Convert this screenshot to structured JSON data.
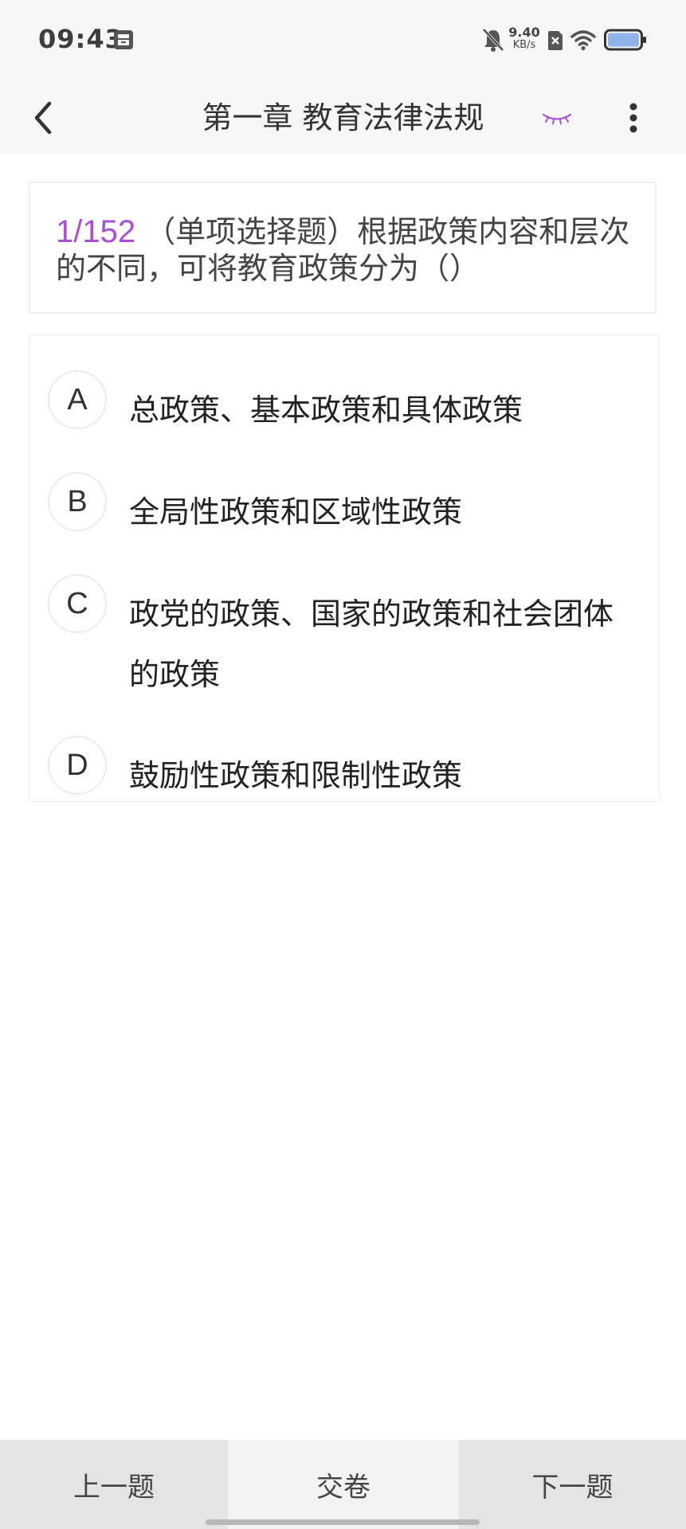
{
  "status_bar": {
    "time": "09:43",
    "net_speed_value": "9.40",
    "net_speed_unit": "KB/s"
  },
  "header": {
    "title": "第一章 教育法律法规"
  },
  "question": {
    "index": "1/152",
    "text": " （单项选择题）根据政策内容和层次的不同，可将教育政策分为（）"
  },
  "options": [
    {
      "letter": "A",
      "text": "总政策、基本政策和具体政策"
    },
    {
      "letter": "B",
      "text": "全局性政策和区域性政策"
    },
    {
      "letter": "C",
      "text": "政党的政策、国家的政策和社会团体的政策"
    },
    {
      "letter": "D",
      "text": "鼓励性政策和限制性政策"
    }
  ],
  "bottom_bar": {
    "prev_label": "上一题",
    "submit_label": "交卷",
    "next_label": "下一题"
  },
  "colors": {
    "accent": "#a64fd6",
    "status_bar_bg": "#f7f7f7",
    "bottom_button_bg": "#e4e4e4"
  },
  "icons": {
    "back": "chevron-left-icon",
    "eye": "eye-closed-icon",
    "more": "more-vertical-icon"
  }
}
